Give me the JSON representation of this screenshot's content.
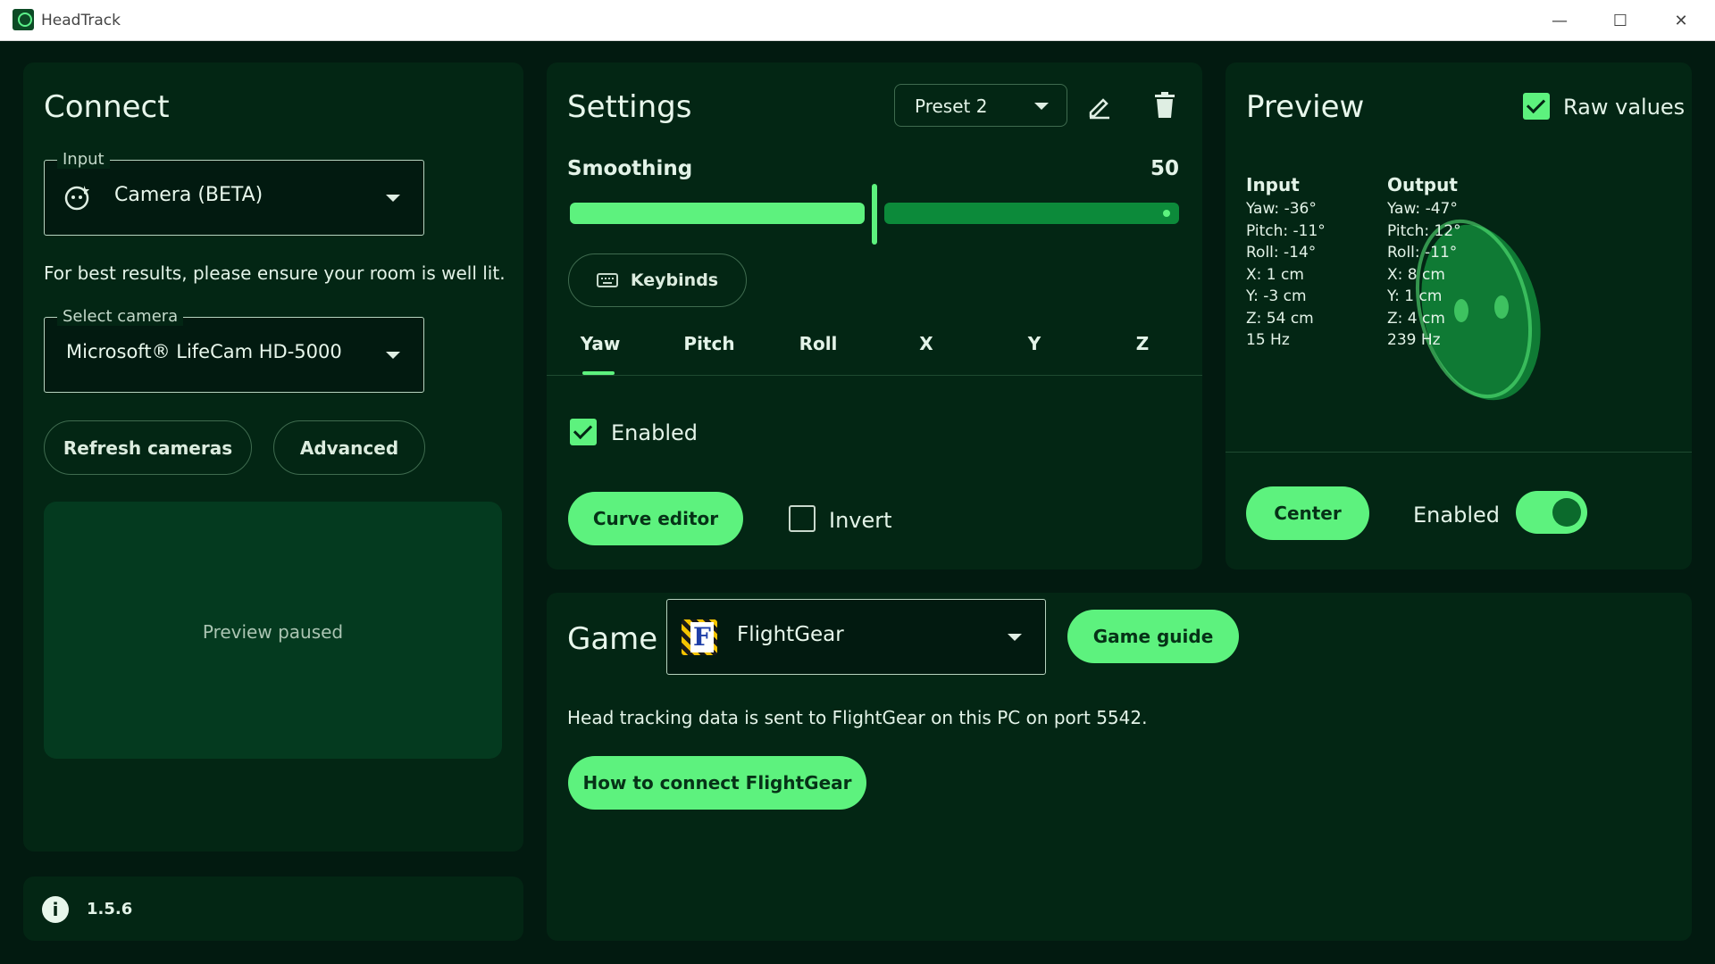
{
  "window": {
    "title": "HeadTrack",
    "minimize": "—",
    "maximize": "☐",
    "close": "✕"
  },
  "connect": {
    "title": "Connect",
    "input_legend": "Input",
    "input_value": "Camera (BETA)",
    "hint": "For best results, please ensure your room is well lit.",
    "camera_legend": "Select camera",
    "camera_value": "Microsoft® LifeCam HD-5000",
    "refresh_label": "Refresh cameras",
    "advanced_label": "Advanced",
    "preview_status": "Preview paused"
  },
  "footer": {
    "version": "1.5.6"
  },
  "settings": {
    "title": "Settings",
    "preset": "Preset 2",
    "smoothing_label": "Smoothing",
    "smoothing_value": "50",
    "smoothing_fraction": 0.5,
    "keybinds_label": "Keybinds",
    "tabs": [
      "Yaw",
      "Pitch",
      "Roll",
      "X",
      "Y",
      "Z"
    ],
    "active_tab": "Yaw",
    "enabled_label": "Enabled",
    "enabled_checked": true,
    "curve_editor_label": "Curve editor",
    "invert_label": "Invert",
    "invert_checked": false
  },
  "preview": {
    "title": "Preview",
    "raw_values_label": "Raw values",
    "raw_values_checked": true,
    "input_header": "Input",
    "input_lines": [
      "Yaw: -36°",
      "Pitch: -11°",
      "Roll: -14°",
      "X: 1 cm",
      "Y: -3 cm",
      "Z: 54 cm",
      "15 Hz"
    ],
    "output_header": "Output",
    "output_lines": [
      "Yaw: -47°",
      "Pitch: 12°",
      "Roll: -11°",
      "X: 8 cm",
      "Y: 1 cm",
      "Z: 4 cm",
      "239 Hz"
    ],
    "center_label": "Center",
    "enabled_label": "Enabled",
    "enabled_on": true
  },
  "game": {
    "title": "Game",
    "selected": "FlightGear",
    "guide_label": "Game guide",
    "info": "Head tracking data is sent to FlightGear on this PC on port 5542.",
    "connect_label": "How to connect FlightGear"
  },
  "colors": {
    "accent": "#5df27e",
    "background": "#021a10",
    "panel": "#032614"
  }
}
